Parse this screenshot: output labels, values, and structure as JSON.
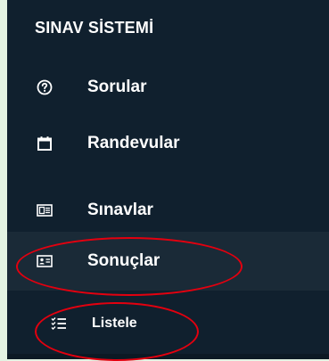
{
  "sidebar": {
    "title": "SINAV SİSTEMİ",
    "items": [
      {
        "label": "Sorular",
        "icon": "question-circle-icon"
      },
      {
        "label": "Randevular",
        "icon": "calendar-icon"
      },
      {
        "label": "Sınavlar",
        "icon": "id-card-icon"
      },
      {
        "label": "Sonuçlar",
        "icon": "profile-card-icon"
      },
      {
        "label": "Listele",
        "icon": "checklist-icon"
      }
    ],
    "colors": {
      "background": "#10202e",
      "active_background": "#1a2a37",
      "text": "#ffffff",
      "annotation": "#e3000f",
      "page_background": "#e4f3e3"
    }
  }
}
